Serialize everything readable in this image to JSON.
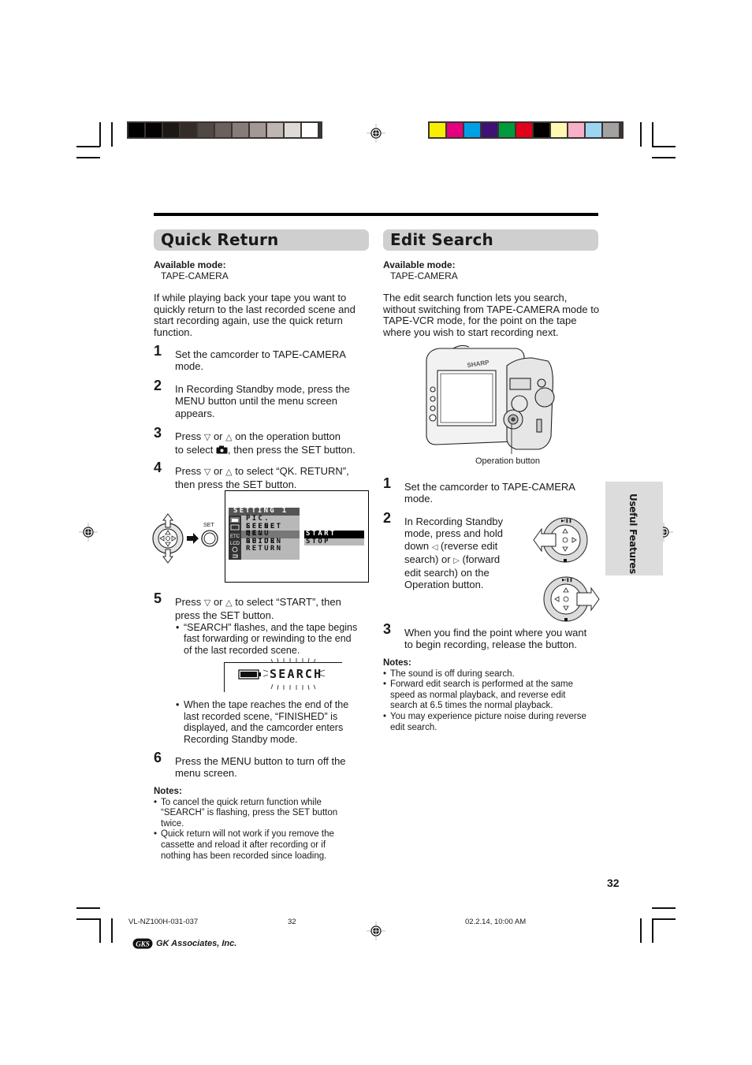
{
  "registration": {
    "gray_swatches": [
      "#000000",
      "#040202",
      "#1c1816",
      "#352c29",
      "#4f4845",
      "#6a615c",
      "#877d78",
      "#a39893",
      "#bfb5b1",
      "#dedad8",
      "#ffffff"
    ],
    "color_swatches": [
      "#f8ef00",
      "#e4007f",
      "#00a0e9",
      "#3f1075",
      "#009b3d",
      "#e2001a",
      "#000000",
      "#fff8b0",
      "#f6b0c8",
      "#9dd4f2",
      "#a2a2a2"
    ]
  },
  "quick_return": {
    "title": "Quick Return",
    "available_mode_label": "Available mode:",
    "available_mode_value": "TAPE-CAMERA",
    "intro": "If while playing back your tape you want to quickly return to the last recorded scene and start recording again, use the quick return function.",
    "steps": [
      {
        "num": "1",
        "lines": [
          "Set the camcorder to TAPE-CAMERA",
          "mode."
        ]
      },
      {
        "num": "2",
        "lines": [
          "In Recording Standby mode, press the",
          "MENU button until the menu screen",
          "appears."
        ]
      },
      {
        "num": "3",
        "line1_a": "Press",
        "line1_b": "or",
        "line1_c": "on the operation button",
        "line2_a": "to select",
        "line2_b": ", then press the SET button."
      },
      {
        "num": "4",
        "line1_a": "Press",
        "line1_b": "or",
        "line1_c": "to select “QK. RETURN”,",
        "line2": "then press the SET button."
      },
      {
        "num": "5",
        "line1_a": "Press",
        "line1_b": "or",
        "line1_c": "to select “START”, then",
        "line2": "press the SET button.",
        "bullet1": [
          "“SEARCH” flashes, and the tape begins",
          "fast forwarding or rewinding to the end",
          "of the last recorded scene."
        ],
        "bullet2": [
          "When the tape reaches the end of the",
          "last recorded scene, “FINISHED” is",
          "displayed, and the camcorder enters",
          "Recording Standby mode."
        ]
      },
      {
        "num": "6",
        "lines": [
          "Press the MENU button to turn off the",
          "menu screen."
        ]
      }
    ],
    "set_label": "SET",
    "menu_screen": {
      "header": "SETTING 1",
      "icons": [
        "camera",
        "scene",
        "ETC",
        "LCD",
        "clock",
        "return"
      ],
      "items": [
        "PIC. EFFECT",
        "SCENE MENU",
        "QK. RETURN",
        "GUIDE",
        "RETURN"
      ],
      "selected_item": "QK. RETURN",
      "submenu": [
        "START",
        "STOP"
      ],
      "selected_submenu": "START"
    },
    "search_display": "SEARCH",
    "notes_label": "Notes:",
    "notes": [
      [
        "To cancel the quick return function while",
        "“SEARCH” is flashing, press the SET button",
        "twice."
      ],
      [
        "Quick return will not work if you remove the",
        "cassette and reload it after recording or if",
        "nothing has been recorded since loading."
      ]
    ]
  },
  "edit_search": {
    "title": "Edit Search",
    "available_mode_label": "Available mode:",
    "available_mode_value": "TAPE-CAMERA",
    "intro": "The edit search function lets you search, without switching from TAPE-CAMERA mode to TAPE-VCR mode, for the point on the tape where you wish to start recording next.",
    "camera_brand": "SHARP",
    "camera_caption": "Operation button",
    "steps": [
      {
        "num": "1",
        "lines": [
          "Set the camcorder to TAPE-CAMERA",
          "mode."
        ]
      },
      {
        "num": "2",
        "l1": "In Recording Standby",
        "l2": "mode, press and hold",
        "l3a": "down",
        "l3b": "(reverse edit",
        "l4a": "search) or",
        "l4b": "(forward",
        "l5": "edit search) on the",
        "l6": "Operation button."
      },
      {
        "num": "3",
        "lines": [
          "When you find the point where you want",
          "to begin recording, release the button."
        ]
      }
    ],
    "notes_label": "Notes:",
    "notes": [
      [
        "The sound is off during search."
      ],
      [
        "Forward edit search is performed at the same",
        "speed as normal playback, and reverse edit",
        "search at 6.5 times the normal playback."
      ],
      [
        "You may experience picture noise during reverse",
        "edit search."
      ]
    ]
  },
  "side_tab": "Useful Features",
  "page_number": "32",
  "footer": {
    "file": "VL-NZ100H-031-037",
    "page": "32",
    "date": "02.2.14, 10:00 AM",
    "logo_mark": "GKS",
    "company": "GK Associates, Inc."
  }
}
